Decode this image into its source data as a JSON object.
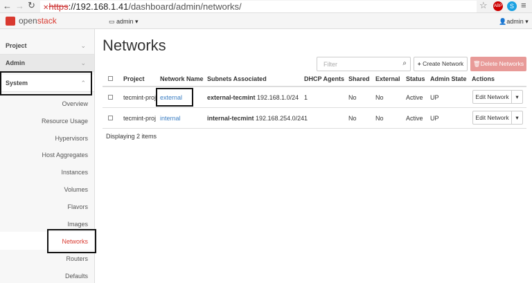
{
  "browser": {
    "url_scheme": "https",
    "url_host": "://192.168.1.41",
    "url_path": "/dashboard/admin/networks/"
  },
  "header": {
    "logo_prefix": "open",
    "logo_suffix": "stack",
    "project_menu": "admin ▾",
    "user_menu": "admin ▾"
  },
  "sidebar": {
    "sections": [
      {
        "label": "Project"
      },
      {
        "label": "Admin"
      },
      {
        "label": "System"
      }
    ],
    "items": [
      "Overview",
      "Resource Usage",
      "Hypervisors",
      "Host Aggregates",
      "Instances",
      "Volumes",
      "Flavors",
      "Images",
      "Networks",
      "Routers",
      "Defaults"
    ],
    "active": "Networks"
  },
  "main": {
    "title": "Networks",
    "filter_placeholder": "Filter",
    "create_label": "Create Network",
    "delete_label": "Delete Networks",
    "columns": [
      "Project",
      "Network Name",
      "Subnets Associated",
      "DHCP Agents",
      "Shared",
      "External",
      "Status",
      "Admin State",
      "Actions"
    ],
    "rows": [
      {
        "project": "tecmint-proj",
        "name": "external",
        "subnet_name": "external-tecmint",
        "subnet_cidr": "192.168.1.0/24",
        "dhcp": "1",
        "shared": "No",
        "external": "No",
        "status": "Active",
        "admin_state": "UP",
        "action": "Edit Network"
      },
      {
        "project": "tecmint-proj",
        "name": "internal",
        "subnet_name": "internal-tecmint",
        "subnet_cidr": "192.168.254.0/24",
        "dhcp": "1",
        "shared": "No",
        "external": "No",
        "status": "Active",
        "admin_state": "UP",
        "action": "Edit Network"
      }
    ],
    "footer": "Displaying 2 items"
  },
  "colors": {
    "accent": "#d9534f",
    "link": "#3a7dc2",
    "delete_btn": "#e89a98"
  }
}
